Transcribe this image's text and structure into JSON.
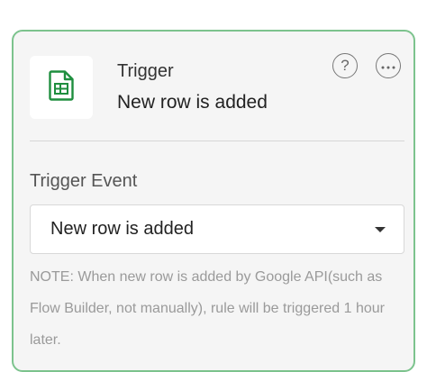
{
  "trigger": {
    "label": "Trigger",
    "name": "New row is added"
  },
  "header_actions": {
    "help_symbol": "?",
    "help_icon": "question-circle-icon",
    "more_icon": "more-horizontal-icon"
  },
  "app_icon": "google-sheets-icon",
  "event": {
    "label": "Trigger Event",
    "selected": "New row is added"
  },
  "note": "NOTE: When new row is added by Google API(such as Flow Builder, not manually), rule will be triggered 1 hour later.",
  "colors": {
    "card_border": "#7cc38d",
    "card_bg": "#f5f5f5",
    "sheets_green": "#1e8e3e"
  }
}
